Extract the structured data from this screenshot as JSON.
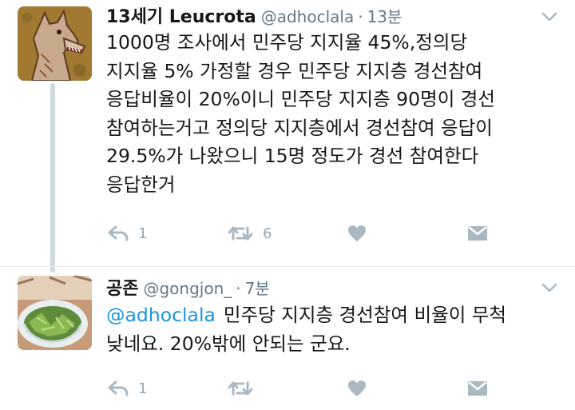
{
  "tweets": [
    {
      "display_name": "13세기 Leucrota",
      "handle": "@adhoclala",
      "separator": "·",
      "time": "13분",
      "text_lines": [
        "1000명 조사에서 민주당 지지율 45%,정의당",
        "지지율 5% 가정할 경우 민주당 지지층 경선참여",
        "응답비율이 20%이니 민주당 지지층 90명이 경선",
        "참여하는거고 정의당 지지층에서 경선참여 응답이",
        "29.5%가 나왔으니 15명 정도가 경선 참여한다",
        "응답한거"
      ],
      "reply_count": "1",
      "retweet_count": "6",
      "avatar_icon": "wolf-creature-avatar"
    },
    {
      "display_name": "공존",
      "handle": "@gongjon_",
      "separator": "·",
      "time": "7분",
      "mention": "@adhoclala",
      "text_line1": "민주당 지지층 경선참여 비율이 무척",
      "text_line2": "낮네요. 20%밖에 안되는 군요.",
      "reply_count": "1",
      "avatar_icon": "salad-bowl-avatar"
    }
  ],
  "colors": {
    "text": "#14171a",
    "secondary": "#657786",
    "link": "#1b95e0",
    "action_icon": "#aab8c2"
  }
}
